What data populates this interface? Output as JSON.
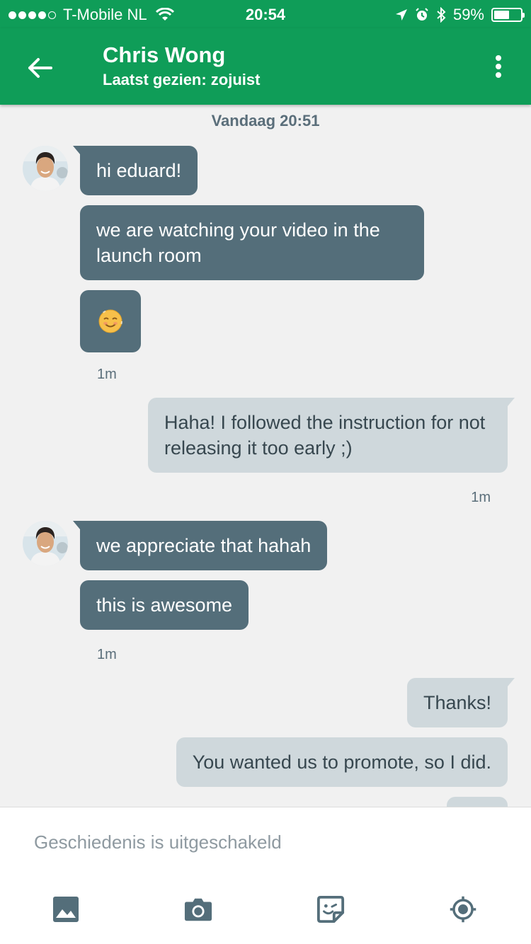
{
  "status_bar": {
    "carrier": "T-Mobile NL",
    "time": "20:54",
    "battery": "59%",
    "battery_level": 0.59,
    "icons": [
      "signal-dots-icon",
      "wifi-icon",
      "location-arrow-icon",
      "alarm-icon",
      "bluetooth-icon",
      "battery-icon"
    ]
  },
  "header": {
    "title": "Chris Wong",
    "subtitle": "Laatst gezien: zojuist",
    "back_icon": "arrow-back-icon",
    "menu_icon": "more-vertical-icon"
  },
  "conversation": {
    "day_stamp": "Vandaag 20:51",
    "messages": [
      {
        "from": "contact",
        "text": "hi eduard!"
      },
      {
        "from": "contact",
        "text": "we are watching your video in the launch room"
      },
      {
        "from": "contact",
        "text": "☺️",
        "kind": "emoji"
      },
      {
        "from": "contact",
        "time": "1m"
      },
      {
        "from": "me",
        "text": "Haha! I followed the instruction for not releasing it too early ;)"
      },
      {
        "from": "me",
        "time": "1m"
      },
      {
        "from": "contact",
        "text": "we appreciate that hahah"
      },
      {
        "from": "contact",
        "text": "this is awesome"
      },
      {
        "from": "contact",
        "time": "1m"
      },
      {
        "from": "me",
        "text": "Thanks!"
      },
      {
        "from": "me",
        "text": "You wanted us to promote, so I did."
      }
    ],
    "times": [
      "1m",
      "1m",
      "1m"
    ]
  },
  "composer": {
    "placeholder": "Geschiedenis is uitgeschakeld",
    "actions": [
      {
        "name": "image-button",
        "icon": "image-icon"
      },
      {
        "name": "camera-button",
        "icon": "camera-icon"
      },
      {
        "name": "sticker-button",
        "icon": "sticker-icon"
      },
      {
        "name": "location-button",
        "icon": "location-target-icon"
      }
    ]
  },
  "colors": {
    "primary": "#0f9d58",
    "incoming_bubble": "#546e7a",
    "outgoing_bubble": "#cfd8dc",
    "background": "#f1f1f1",
    "icon_gray": "#546e7a"
  }
}
